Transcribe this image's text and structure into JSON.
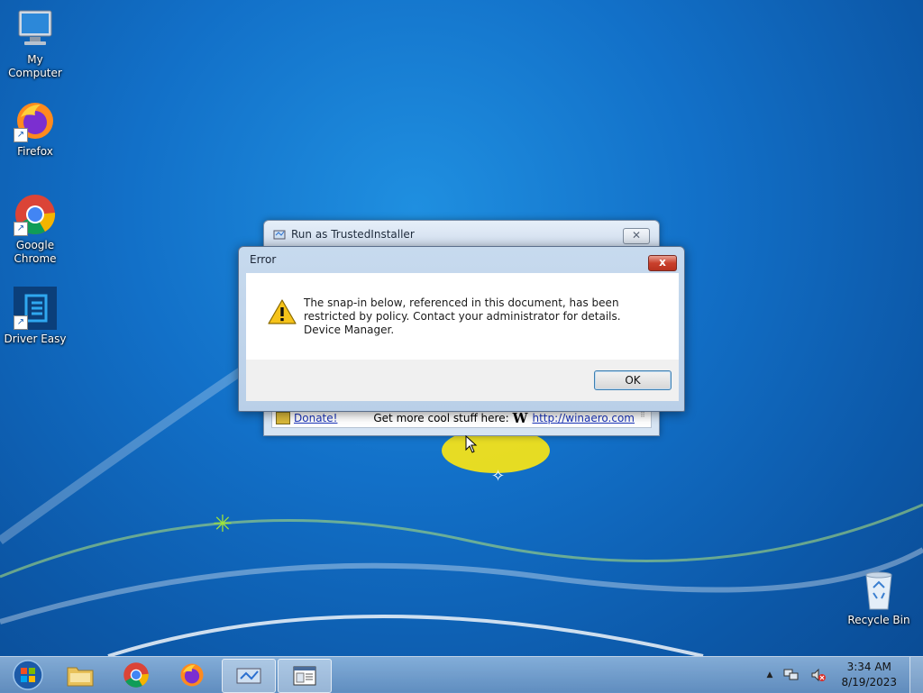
{
  "desktop": {
    "icons": [
      {
        "label": "My Computer"
      },
      {
        "label": "Firefox"
      },
      {
        "label": "Google\nChrome"
      },
      {
        "label": "Driver Easy"
      },
      {
        "label": "Recycle Bin"
      }
    ]
  },
  "background_window": {
    "title": "Run as TrustedInstaller",
    "close_symbol": "✕",
    "donate_link": "Donate!",
    "promo_text": "Get more cool stuff here:",
    "logo_letter": "W",
    "site_link": "http://winaero.com"
  },
  "error_dialog": {
    "title": "Error",
    "close_symbol": "x",
    "message_line1": "The snap-in below, referenced in this document, has been restricted by policy. Contact your administrator for details.",
    "message_line2": "Device Manager.",
    "ok_label": "OK"
  },
  "taskbar": {
    "items": [
      "start-orb",
      "explorer",
      "chrome",
      "firefox",
      "run-as-trustedinstaller",
      "mmc"
    ],
    "time": "3:34 AM",
    "date": "8/19/2023",
    "tray_arrow": "▲"
  },
  "colors": {
    "desktop_blue": "#1270c8",
    "close_red": "#c9402c",
    "link_blue": "#1a33b8"
  }
}
